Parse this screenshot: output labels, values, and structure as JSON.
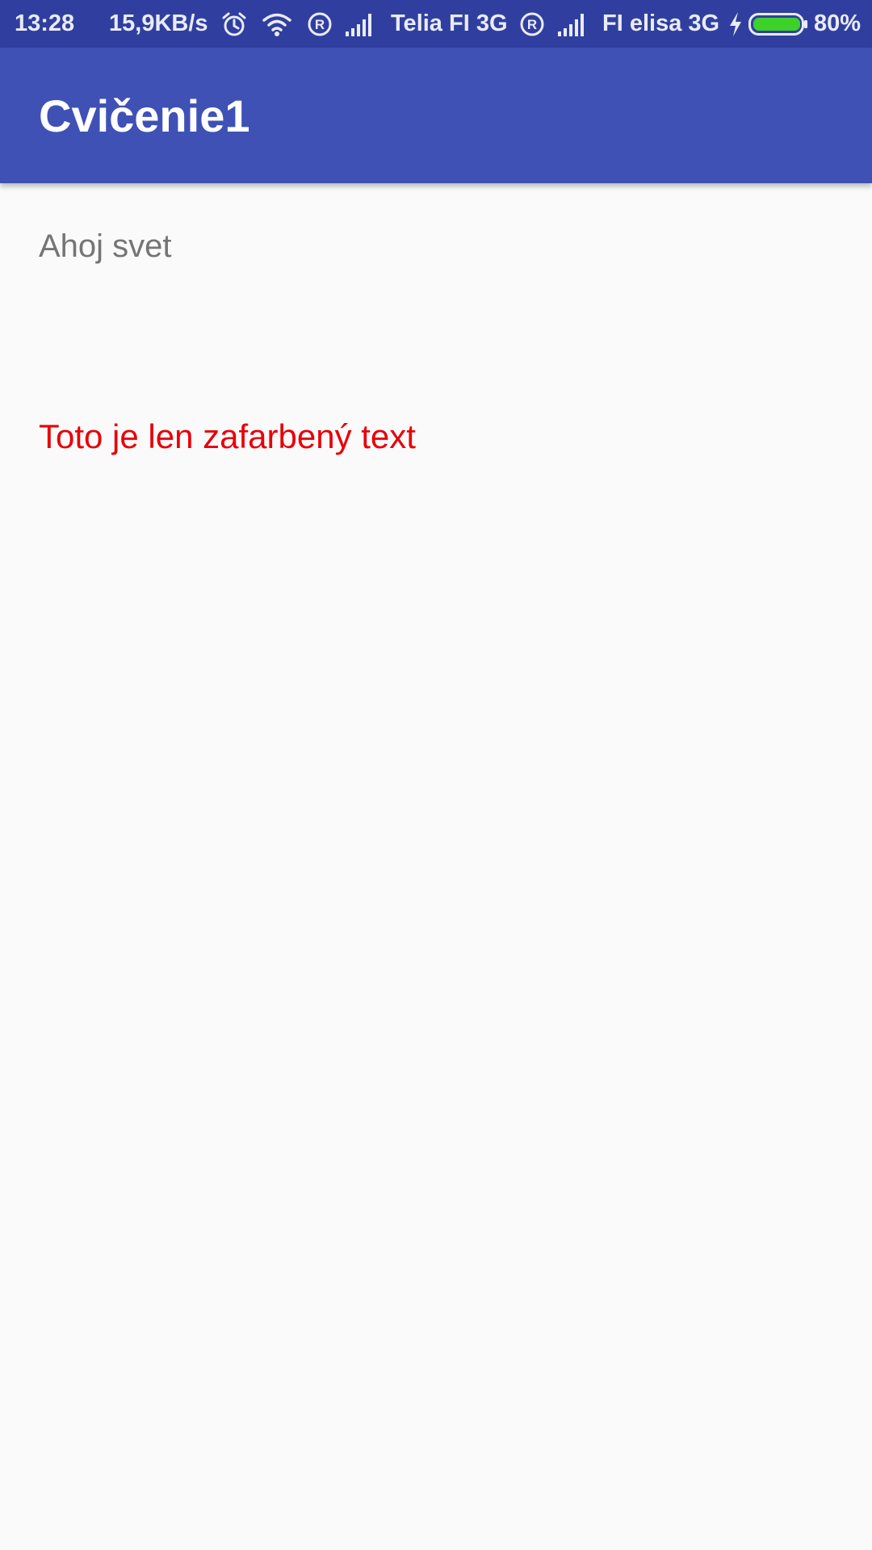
{
  "status_bar": {
    "time": "13:28",
    "network_speed": "15,9KB/s",
    "carrier_1": "Telia FI 3G",
    "carrier_2": "FI elisa 3G",
    "battery_percent": "80%",
    "battery_level": 0.8,
    "icons": [
      "alarm-icon",
      "wifi-icon",
      "roaming-icon",
      "signal-icon",
      "charging-icon",
      "battery-icon"
    ],
    "background_color": "#303f9f",
    "battery_color": "#3dd12a"
  },
  "app_bar": {
    "title": "Cvičenie1",
    "background_color": "#3f51b5"
  },
  "main": {
    "hello_text": "Ahoj svet",
    "colored_text": "Toto je len zafarbený text",
    "colored_text_color": "#e8000a"
  }
}
